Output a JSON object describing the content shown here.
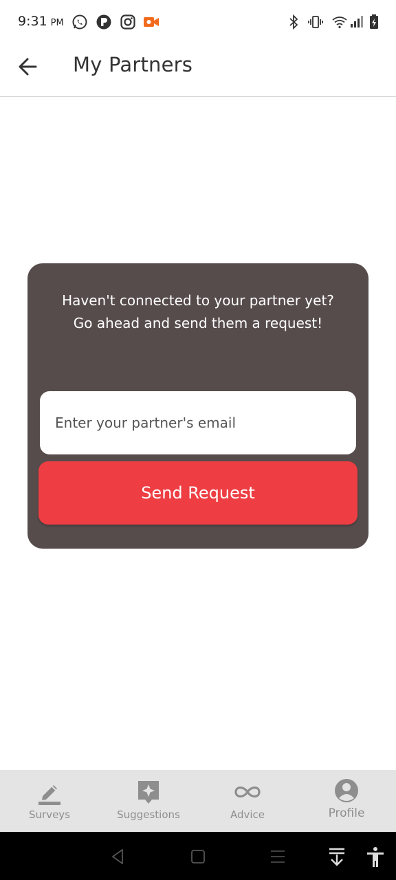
{
  "status_bar": {
    "time": "9:31",
    "ampm": "PM",
    "left_icons": [
      "whatsapp-icon",
      "p-app-icon",
      "instagram-icon",
      "video-record-icon"
    ],
    "right_icons": [
      "bluetooth-icon",
      "vibrate-icon",
      "wifi-icon",
      "signal-icon",
      "battery-charging-icon"
    ]
  },
  "header": {
    "title": "My Partners"
  },
  "card": {
    "message_line1": "Haven't connected to your partner yet?",
    "message_line2": "Go ahead and send them a request!",
    "email_placeholder": "Enter your partner's email",
    "email_value": "",
    "send_label": "Send Request"
  },
  "bottom_nav": {
    "items": [
      {
        "label": "Surveys",
        "icon": "pencil-icon"
      },
      {
        "label": "Suggestions",
        "icon": "sparkle-badge-icon"
      },
      {
        "label": "Advice",
        "icon": "infinity-icon"
      },
      {
        "label": "Profile",
        "icon": "user-circle-icon"
      }
    ]
  },
  "colors": {
    "card_bg": "#574c4c",
    "accent": "#ee3e43",
    "nav_bg": "#e4e4e4",
    "nav_icon": "#8e8e8e"
  }
}
